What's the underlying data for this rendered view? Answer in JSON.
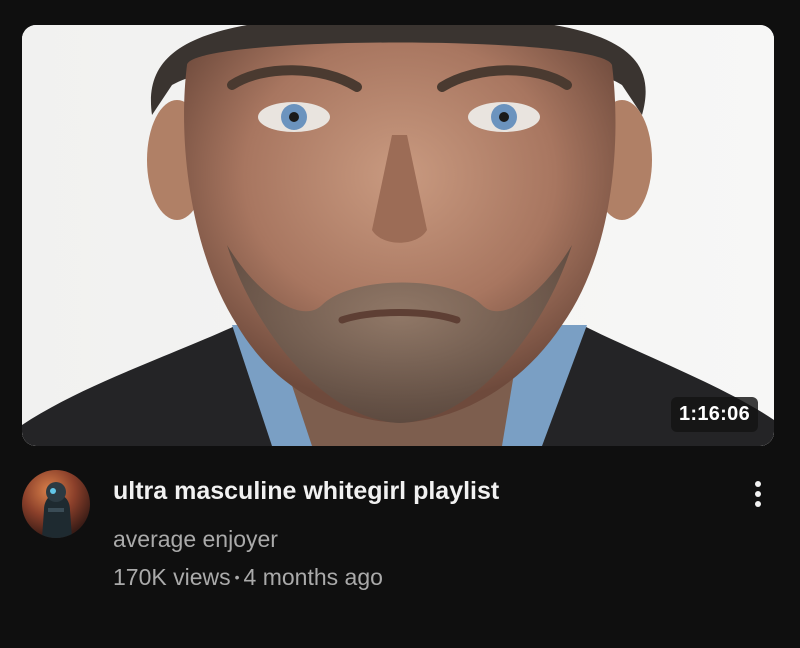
{
  "video": {
    "duration": "1:16:06",
    "title": "ultra masculine whitegirl playlist",
    "channel": "average enjoyer",
    "views": "170K views",
    "separator": "•",
    "age": "4 months ago"
  },
  "colors": {
    "background": "#0f0f0f",
    "title_text": "#f1f1f1",
    "secondary_text": "#aaaaaa",
    "duration_badge": "#141414"
  },
  "icons": {
    "menu": "more-vert-icon"
  }
}
